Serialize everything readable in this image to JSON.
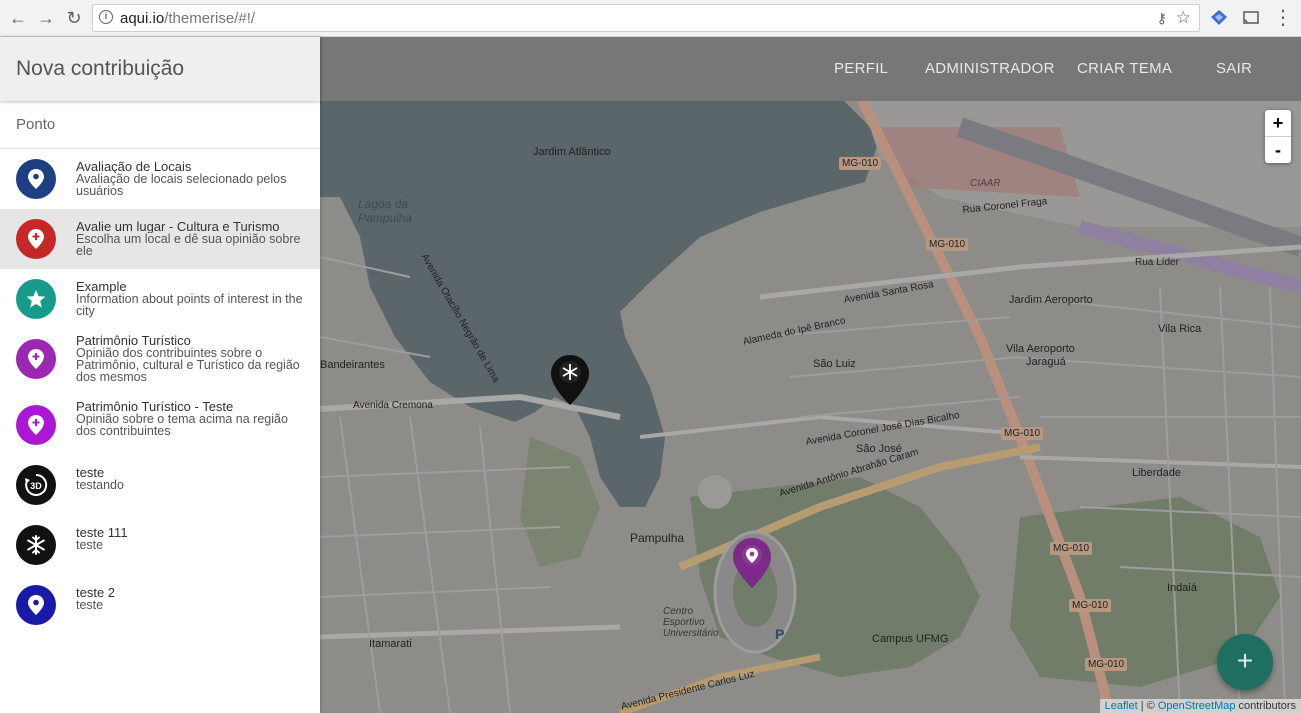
{
  "browser": {
    "url_host": "aqui.io",
    "url_path": "/themerise/#!/"
  },
  "nav": {
    "links": [
      "PERFIL",
      "ADMINISTRADOR",
      "CRIAR TEMA",
      "SAIR"
    ]
  },
  "sidebar": {
    "title": "Nova contribuição",
    "section": "Ponto",
    "items": [
      {
        "title": "Avaliação de Locais",
        "desc": "Avaliação de locais selecionado pelos usuários",
        "color": "#1e3f82",
        "icon": "map-marker-icon"
      },
      {
        "title": "Avalie um lugar - Cultura e Turismo",
        "desc": "Escolha um local e dê sua opinião sobre ele",
        "color": "#c62828",
        "icon": "map-marker-plus-icon"
      },
      {
        "title": "Example",
        "desc": "Information about points of interest in the city",
        "color": "#169b8a",
        "icon": "star-icon"
      },
      {
        "title": "Patrimônio Turístico",
        "desc": "Opinião dos contribuintes sobre o Patrimônio, cultural e Turístico da região dos mesmos",
        "color": "#9c27b0",
        "icon": "map-marker-plus-icon"
      },
      {
        "title": "Patrimônio Turístico - Teste",
        "desc": "Opinião sobre o tema acima na região dos contribuintes",
        "color": "#aa18d6",
        "icon": "map-marker-plus-icon"
      },
      {
        "title": "teste",
        "desc": "testando",
        "color": "#111111",
        "icon": "rotate-3d-icon"
      },
      {
        "title": "teste 111",
        "desc": "teste",
        "color": "#111111",
        "icon": "snowflake-icon"
      },
      {
        "title": "teste 2",
        "desc": "teste",
        "color": "#1a1aa8",
        "icon": "map-marker-icon"
      }
    ]
  },
  "map": {
    "labels": [
      "Lagoa da Pampulha",
      "Pampulha",
      "Campus UFMG",
      "Jardim Atlântico",
      "Jardim Aeroporto",
      "Vila Aeroporto",
      "Vila Rica",
      "Bandeirantes",
      "Itamarati",
      "Liberdade",
      "Indaiá",
      "São Luiz",
      "São José",
      "Jaraguá",
      "Centro Esportivo Universitário",
      "CIAAR",
      "Avenida Antônio Abrahão Caram",
      "Avenida Presidente Carlos Luz",
      "Avenida Otacílio Negrão de Lima",
      "Avenida Cremona",
      "Avenida Santa Rosa",
      "Alameda do Ipê Branco",
      "Avenida Coronel José Dias Bicalho",
      "Rua Coronel Fraga",
      "Rua Líder"
    ],
    "road_badges": [
      "MG-010",
      "MG-010",
      "MG-010",
      "MG-010",
      "MG-010",
      "MG-010"
    ],
    "zoom_in": "+",
    "zoom_out": "-",
    "attribution": {
      "leaflet": "Leaflet",
      "sep": " | © ",
      "osm": "OpenStreetMap",
      "suffix": " contributors"
    },
    "fab_label": "+"
  }
}
